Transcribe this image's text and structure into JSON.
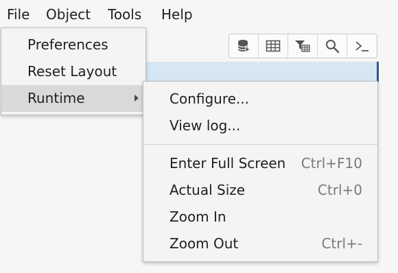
{
  "menubar": {
    "items": [
      "File",
      "Object",
      "Tools",
      "Help"
    ]
  },
  "toolbar": {
    "buttons": [
      {
        "icon": "database-icon"
      },
      {
        "icon": "table-icon"
      },
      {
        "icon": "filter-table-icon"
      },
      {
        "icon": "search-icon"
      },
      {
        "icon": "terminal-icon"
      }
    ]
  },
  "file_menu": {
    "items": [
      "Preferences",
      "Reset Layout",
      "Runtime"
    ],
    "active_item": "Runtime"
  },
  "runtime_menu": {
    "items": [
      {
        "label": "Configure...",
        "shortcut": ""
      },
      {
        "label": "View log...",
        "shortcut": ""
      },
      {
        "label": "Enter Full Screen",
        "shortcut": "Ctrl+F10"
      },
      {
        "label": "Actual Size",
        "shortcut": "Ctrl+0"
      },
      {
        "label": "Zoom In",
        "shortcut": ""
      },
      {
        "label": "Zoom Out",
        "shortcut": "Ctrl+-"
      }
    ]
  },
  "colors": {
    "menu_bg": "#f4f4f4",
    "active_bg": "#d9d9d9",
    "selected_row": "#d6e6f3",
    "shortcut_text": "#7a7a7a"
  }
}
